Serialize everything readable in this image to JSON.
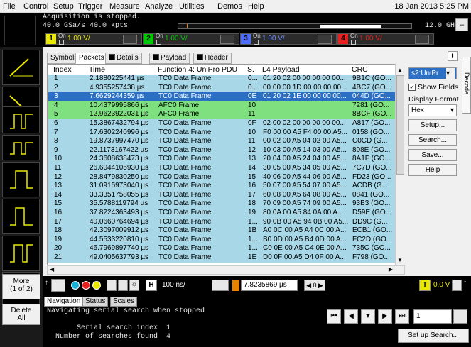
{
  "menu": {
    "items": [
      "File",
      "Control",
      "Setup",
      "Trigger",
      "Measure",
      "Analyze",
      "Utilities",
      "Demos",
      "Help"
    ],
    "datetime": "18 Jan 2013  5:25 PM"
  },
  "status": {
    "line1": "Acquisition is stopped.",
    "line2": "40.0 GSa/s   40.0 kpts",
    "bandwidth": "12.0 GHz"
  },
  "channels": [
    {
      "num": "1",
      "on_label": "On",
      "value": "1.00 V/",
      "color": "#e8e800"
    },
    {
      "num": "2",
      "on_label": "On",
      "value": "1.00 V/",
      "color": "#00c800"
    },
    {
      "num": "3",
      "on_label": "On",
      "value": "1.00 V/",
      "color": "#4a6cff"
    },
    {
      "num": "4",
      "on_label": "On",
      "value": "1.00 V/",
      "color": "#e82020"
    }
  ],
  "tabs": [
    {
      "label": "Symbols",
      "active": false
    },
    {
      "label": "Packets",
      "active": true
    },
    {
      "label": "Details",
      "active": false
    },
    {
      "label": "Payload",
      "active": false
    },
    {
      "label": "Header",
      "active": false
    }
  ],
  "table": {
    "headers": [
      "Index",
      "Time",
      "Function 4: UniPro PDU",
      "S.",
      "L4 Payload",
      "CRC"
    ],
    "rows": [
      {
        "index": "1",
        "time": "2.1880225441 µs",
        "func": "TC0 Data Frame",
        "s": "0...",
        "payload": "01 20 02 00 00 00 00 00...",
        "crc": "9B1C (GO...",
        "kind": "blue"
      },
      {
        "index": "2",
        "time": "4.9355257438 µs",
        "func": "TC0 Data Frame",
        "s": "0...",
        "payload": "00 00 00 1D 00 00 00 00...",
        "crc": "4BC7 (GO...",
        "kind": "blue"
      },
      {
        "index": "3",
        "time": "7.6629244359 µs",
        "func": "TC0 Data Frame",
        "s": "0E",
        "payload": "01 20 02 1E 00 00 00 00...",
        "crc": "044D (GO...",
        "kind": "sel"
      },
      {
        "index": "4",
        "time": "10.4379995866 µs",
        "func": "AFC0 Frame",
        "s": "10",
        "payload": "",
        "crc": "7281 (GO...",
        "kind": "green"
      },
      {
        "index": "5",
        "time": "12.9623922031 µs",
        "func": "AFC0 Frame",
        "s": "11",
        "payload": "",
        "crc": "8BCF (GO...",
        "kind": "green"
      },
      {
        "index": "6",
        "time": "15.3867432794 µs",
        "func": "TC0 Data Frame",
        "s": "0F",
        "payload": "02 00 02 00 00 00 00 00...",
        "crc": "A817 (GO...",
        "kind": "blue"
      },
      {
        "index": "7",
        "time": "17.6302240996 µs",
        "func": "TC0 Data Frame",
        "s": "10",
        "payload": "F0 00 00 A5 F4 00 00 A5...",
        "crc": "0158 (GO...",
        "kind": "blue"
      },
      {
        "index": "8",
        "time": "19.8737997470 µs",
        "func": "TC0 Data Frame",
        "s": "11",
        "payload": "00 02 00 A5 04 02 00 A5...",
        "crc": "C0CD (G...",
        "kind": "blue"
      },
      {
        "index": "9",
        "time": "22.1173167422 µs",
        "func": "TC0 Data Frame",
        "s": "12",
        "payload": "10 03 00 A5 14 03 00 A5...",
        "crc": "808E (GO...",
        "kind": "blue"
      },
      {
        "index": "10",
        "time": "24.3608638473 µs",
        "func": "TC0 Data Frame",
        "s": "13",
        "payload": "20 04 00 A5 24 04 00 A5...",
        "crc": "8A1F (GO...",
        "kind": "blue"
      },
      {
        "index": "11",
        "time": "26.6044105930 µs",
        "func": "TC0 Data Frame",
        "s": "14",
        "payload": "30 05 00 A5 34 05 00 A5...",
        "crc": "7C7D (GO...",
        "kind": "blue"
      },
      {
        "index": "12",
        "time": "28.8479830250 µs",
        "func": "TC0 Data Frame",
        "s": "15",
        "payload": "40 06 00 A5 44 06 00 A5...",
        "crc": "FD23 (GO...",
        "kind": "blue"
      },
      {
        "index": "13",
        "time": "31.0915973040 µs",
        "func": "TC0 Data Frame",
        "s": "16",
        "payload": "50 07 00 A5 54 07 00 A5...",
        "crc": "ACDB (G...",
        "kind": "blue"
      },
      {
        "index": "14",
        "time": "33.3351758055 µs",
        "func": "TC0 Data Frame",
        "s": "17",
        "payload": "60 08 00 A5 64 08 00 A5...",
        "crc": "0841 (GO...",
        "kind": "blue"
      },
      {
        "index": "15",
        "time": "35.5788119794 µs",
        "func": "TC0 Data Frame",
        "s": "18",
        "payload": "70 09 00 A5 74 09 00 A5...",
        "crc": "93B3 (GO...",
        "kind": "blue"
      },
      {
        "index": "16",
        "time": "37.8224363493 µs",
        "func": "TC0 Data Frame",
        "s": "19",
        "payload": "80 0A 00 A5 84 0A 00 A...",
        "crc": "D59E (GO...",
        "kind": "blue"
      },
      {
        "index": "17",
        "time": "40.0660764694 µs",
        "func": "TC0 Data Frame",
        "s": "1...",
        "payload": "90 0B 00 A5 94 0B 00 A5...",
        "crc": "DD9C (G...",
        "kind": "blue"
      },
      {
        "index": "18",
        "time": "42.3097009912 µs",
        "func": "TC0 Data Frame",
        "s": "1B",
        "payload": "A0 0C 00 A5 A4 0C 00 A...",
        "crc": "ECB1 (GO...",
        "kind": "blue"
      },
      {
        "index": "19",
        "time": "44.5533220810 µs",
        "func": "TC0 Data Frame",
        "s": "1...",
        "payload": "B0 0D 00 A5 B4 0D 00 A...",
        "crc": "FC2D (GO...",
        "kind": "blue"
      },
      {
        "index": "20",
        "time": "46.7969897740 µs",
        "func": "TC0 Data Frame",
        "s": "1...",
        "payload": "C0 0E 00 A5 C4 0E 00 A...",
        "crc": "735C (GO...",
        "kind": "blue"
      },
      {
        "index": "21",
        "time": "49.0405637793 µs",
        "func": "TC0 Data Frame",
        "s": "1E",
        "payload": "D0 0F 00 A5 D4 0F 00 A...",
        "crc": "F798 (GO...",
        "kind": "blue"
      }
    ]
  },
  "right_panel": {
    "protocol_select": "s2:UniPr",
    "show_fields": "Show Fields",
    "display_format_label": "Display Format",
    "display_format_value": "Hex",
    "setup": "Setup...",
    "search": "Search...",
    "save": "Save...",
    "help": "Help",
    "decode_tab": "Decode"
  },
  "left_panel": {
    "more": "More",
    "more_page": "(1 of 2)",
    "delete": "Delete",
    "delete_all": "All"
  },
  "bottom": {
    "timebase": "100 ns/",
    "time_position": "7.8235869 µs",
    "trigger_level": "0.0 V"
  },
  "nav": {
    "tabs": [
      "Navigation",
      "Status",
      "Scales"
    ],
    "line1": "Navigating serial search when stopped",
    "line2": "       Serial search index  1",
    "line3": "  Number of searches found  4",
    "index_value": "1",
    "setup_search": "Set up Search..."
  },
  "colors": {
    "row_blue": "#a8d8e8",
    "row_green": "#7ee07e",
    "row_selected": "#2b6fc4"
  }
}
